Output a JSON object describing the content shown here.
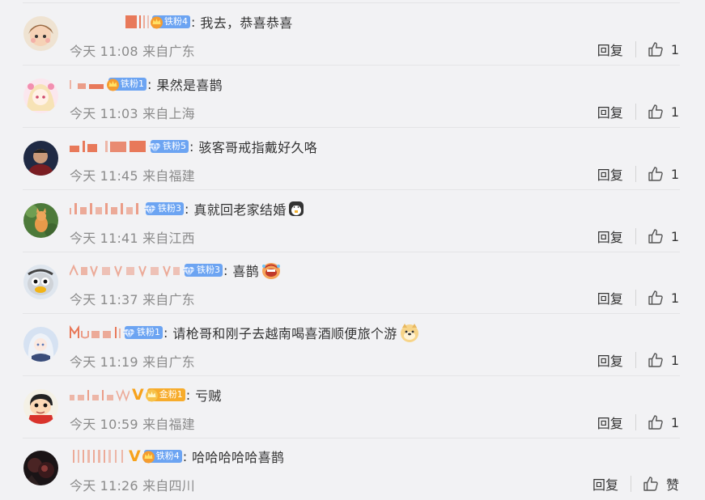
{
  "colors": {
    "background": "#f2f2f4",
    "fan_badge_blue": "#6ca4f2",
    "fan_badge_gold": "#f7ac2c",
    "meta_gray": "#8b8b8b",
    "verified_v": "#f7a21b"
  },
  "comments": [
    {
      "avatar": "cartoon-avatar-1",
      "fan_badge": {
        "label": "铁粉4",
        "icon": "crown-icon",
        "tier": "blue"
      },
      "text": "我去，恭喜恭喜",
      "emoji": null,
      "verified": false,
      "time": "今天 11:08 来自广东",
      "reply_label": "回复",
      "like_label": "1"
    },
    {
      "avatar": "anime-girl-avatar",
      "fan_badge": {
        "label": "铁粉1",
        "icon": "crown-icon",
        "tier": "blue"
      },
      "text": "果然是喜鹊",
      "emoji": null,
      "verified": false,
      "time": "今天 11:03 来自上海",
      "reply_label": "回复",
      "like_label": "1"
    },
    {
      "avatar": "photo-avatar-man",
      "fan_badge": {
        "label": "铁粉5",
        "icon": "diamond-icon",
        "tier": "blue"
      },
      "text": "骇客哥戒指戴好久咯",
      "emoji": null,
      "verified": false,
      "time": "今天 11:45 来自福建",
      "reply_label": "回复",
      "like_label": "1"
    },
    {
      "avatar": "cat-photo-avatar",
      "fan_badge": {
        "label": "铁粉3",
        "icon": "diamond-icon",
        "tier": "blue"
      },
      "text": "真就回老家结婚",
      "emoji": "penguin-emoji",
      "verified": false,
      "time": "今天 11:41 来自江西",
      "reply_label": "回复",
      "like_label": "1"
    },
    {
      "avatar": "cartoon-duck-avatar",
      "fan_badge": {
        "label": "铁粉3",
        "icon": "diamond-icon",
        "tier": "blue"
      },
      "text": "喜鹊",
      "emoji": "laughing-emoji",
      "verified": false,
      "time": "今天 11:37 来自广东",
      "reply_label": "回复",
      "like_label": "1"
    },
    {
      "avatar": "anime-white-hair-avatar",
      "fan_badge": {
        "label": "铁粉1",
        "icon": "diamond-icon",
        "tier": "blue"
      },
      "text": "请枪哥和刚子去越南喝喜酒顺便旅个游",
      "emoji": "doge-emoji",
      "verified": false,
      "time": "今天 11:19 来自广东",
      "reply_label": "回复",
      "like_label": "1"
    },
    {
      "avatar": "crayon-shin-chan-avatar",
      "fan_badge": {
        "label": "金粉1",
        "icon": "crown-icon",
        "tier": "gold"
      },
      "text": "亏贼",
      "emoji": null,
      "verified": true,
      "verified_mark": "V",
      "time": "今天 10:59 来自福建",
      "reply_label": "回复",
      "like_label": "1"
    },
    {
      "avatar": "dark-portrait-avatar",
      "fan_badge": {
        "label": "铁粉4",
        "icon": "crown-icon",
        "tier": "blue"
      },
      "text": "哈哈哈哈哈喜鹊",
      "emoji": null,
      "verified": true,
      "verified_mark": "V",
      "time": "今天 11:26 来自四川",
      "reply_label": "回复",
      "like_label": "赞"
    }
  ]
}
